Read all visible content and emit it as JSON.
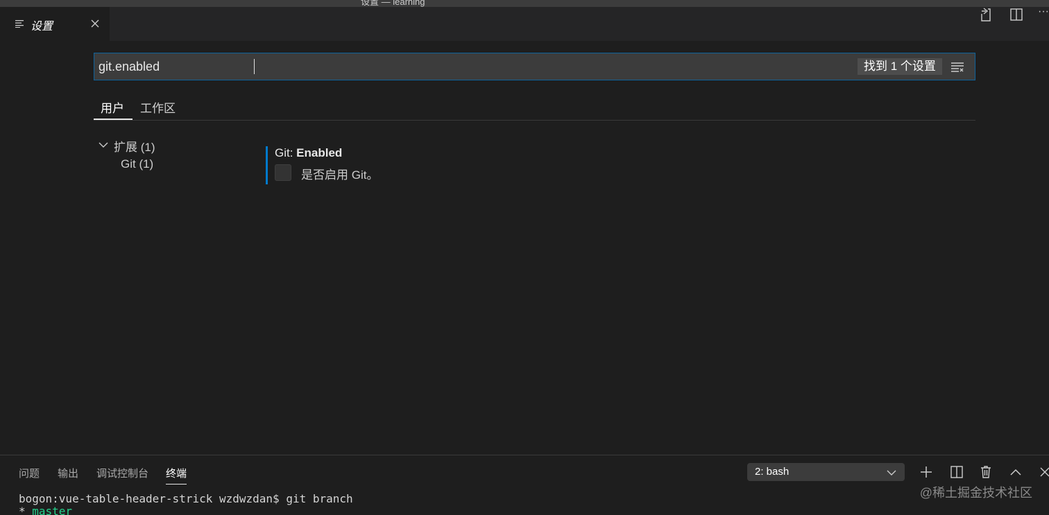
{
  "window": {
    "title": "设置 — learning"
  },
  "editor_tab": {
    "label": "设置",
    "icon": "settings-list-icon",
    "close_icon": "close-icon"
  },
  "editor_actions": [
    {
      "name": "open-settings-json-icon"
    },
    {
      "name": "split-editor-icon"
    },
    {
      "name": "more-actions-icon",
      "glyph": "···"
    }
  ],
  "search": {
    "value": "git.enabled",
    "result_count": "找到 1 个设置",
    "filter_icon": "clear-filter-icon"
  },
  "scope_tabs": [
    {
      "label": "用户",
      "active": true
    },
    {
      "label": "工作区",
      "active": false
    }
  ],
  "toc": {
    "group": {
      "label": "扩展 (1)",
      "expanded": true
    },
    "child": {
      "label": "Git (1)"
    }
  },
  "setting": {
    "category": "Git: ",
    "name": "Enabled",
    "description": "是否启用 Git。",
    "checked": false
  },
  "panel": {
    "tabs": [
      {
        "label": "问题",
        "active": false
      },
      {
        "label": "输出",
        "active": false
      },
      {
        "label": "调试控制台",
        "active": false
      },
      {
        "label": "终端",
        "active": true
      }
    ],
    "terminal_select": "2: bash",
    "actions": [
      "new-terminal-icon",
      "split-terminal-icon",
      "kill-terminal-icon",
      "maximize-panel-icon",
      "close-panel-icon"
    ]
  },
  "terminal": {
    "line1": "bogon:vue-table-header-strick wzdwzdan$ git branch",
    "line2_prefix": "* ",
    "line2_branch": "master"
  },
  "watermark": "@稀土掘金技术社区",
  "colors": {
    "accent": "#007acc",
    "background": "#1e1e1e",
    "branch_green": "#23d18b"
  }
}
